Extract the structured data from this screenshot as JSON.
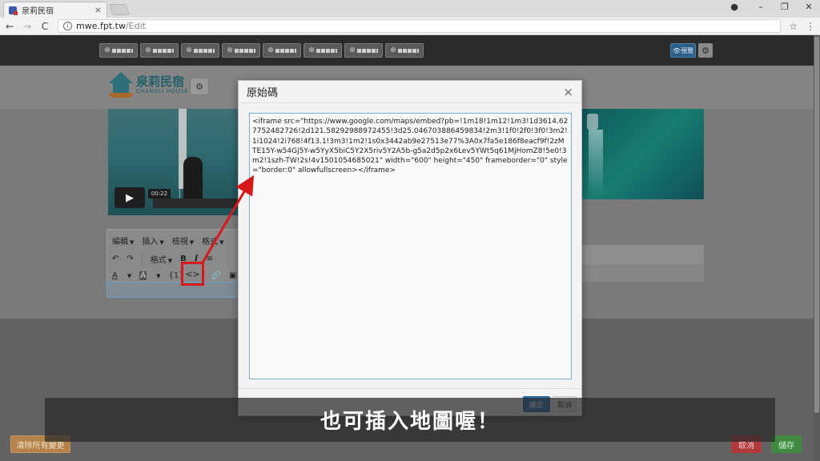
{
  "browser": {
    "tab_title": "泉莉民宿",
    "tab_close": "×",
    "url_host": "mwe.fpt.tw",
    "url_path": "/Edit",
    "nav_back": "←",
    "nav_forward": "→",
    "nav_reload": "C",
    "star": "☆",
    "menu": "⋮",
    "win_min": "–",
    "win_max": "❐",
    "win_close": "✕",
    "profile": "●"
  },
  "topbar": {
    "preview_label": "👁預覽",
    "gear": "⚙",
    "tool_buttons": [
      "⊕",
      "⊕",
      "⊕",
      "⊕",
      "⊕",
      "⊕",
      "⊕",
      "⊕"
    ]
  },
  "logo": {
    "name": "泉莉民宿",
    "subtitle": "CHANGLI HOUSE",
    "gear": "⚙"
  },
  "video": {
    "play": "▶",
    "time": "00:22"
  },
  "editor_toolbar": {
    "menu_edit": "編輯",
    "menu_insert": "插入",
    "menu_view": "檢視",
    "menu_format": "格式",
    "undo": "↶",
    "redo": "↷",
    "format_dropdown": "格式",
    "bold": "B",
    "italic": "I",
    "align": "≡",
    "font_color": "A",
    "bg_color": "A",
    "var": "{1}",
    "source_code": "<>",
    "link": "🔗",
    "image": "▣"
  },
  "modal": {
    "title": "原始碼",
    "close": "×",
    "code": "<iframe src=\"https://www.google.com/maps/embed?pb=!1m18!1m12!1m3!1d3614.627752482726!2d121.58292988972455!3d25.046703886459834!2m3!1f0!2f0!3f0!3m2!1i1024!2i768!4f13.1!3m3!1m2!1s0x3442ab9e27513e77%3A0x7fa5e186f8eacf9f!2zMTE15Y-w54Gj5Y-w5YyX5biC5Y2X5riv5Y2A5b-g5a2d5p2x6Lev5YWt5q61MjHomZ8!5e0!3m2!1szh-TW!2s!4v1501054685021\" width=\"600\" height=\"450\" frameborder=\"0\" style=\"border:0\" allowfullscreen></iframe>",
    "ok_label": "確定",
    "cancel_label": "取消"
  },
  "bottom": {
    "clear_label": "清除所有變更",
    "cancel_label": "取消",
    "save_label": "儲存"
  },
  "subtitle": "也可插入地圖喔！",
  "colors": {
    "annotation_red": "#d8191b",
    "primary_blue": "#2f75b5"
  }
}
